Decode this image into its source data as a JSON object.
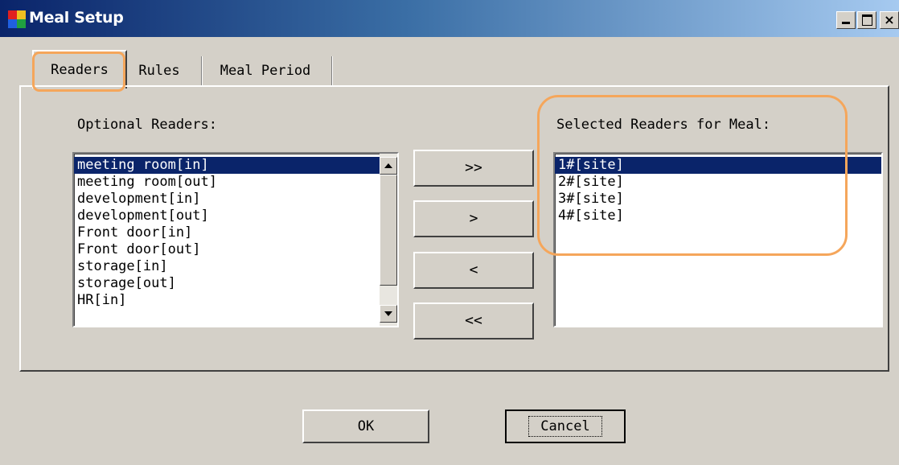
{
  "window": {
    "title": "Meal Setup"
  },
  "tabs": [
    {
      "label": "Readers",
      "active": true
    },
    {
      "label": "Rules",
      "active": false
    },
    {
      "label": "Meal Period",
      "active": false
    }
  ],
  "optional_readers": {
    "label": "Optional Readers:",
    "items": [
      "meeting room[in]",
      "meeting room[out]",
      "development[in]",
      "development[out]",
      "Front door[in]",
      "Front door[out]",
      "storage[in]",
      "storage[out]",
      "HR[in]"
    ],
    "selected_index": 0
  },
  "selected_readers": {
    "label": "Selected Readers for Meal:",
    "items": [
      "1#[site]",
      "2#[site]",
      "3#[site]",
      "4#[site]"
    ],
    "selected_index": 0
  },
  "transfer_buttons": {
    "add_all": ">>",
    "add": ">",
    "remove": "<",
    "remove_all": "<<"
  },
  "dialog_buttons": {
    "ok": "OK",
    "cancel": "Cancel"
  },
  "colors": {
    "highlight_annotation": "#f5a65b",
    "selection": "#0a246a"
  }
}
